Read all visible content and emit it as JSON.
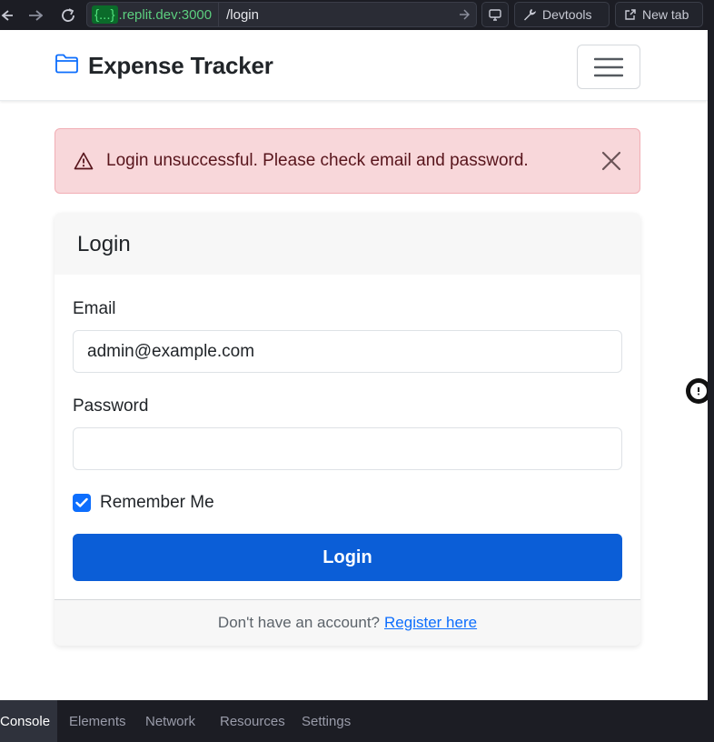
{
  "browser": {
    "url_chip": "{...}",
    "url_host": ".replit.dev:3000",
    "url_path": "/login",
    "devtools_label": "Devtools",
    "newtab_label": "New tab"
  },
  "navbar": {
    "brand_title": "Expense Tracker",
    "brand_icon": "folder-icon",
    "toggler_icon": "hamburger-icon"
  },
  "alert": {
    "message": "Login unsuccessful. Please check email and password.",
    "icon": "warning-icon",
    "color": "#f8d7da"
  },
  "login_card": {
    "title": "Login",
    "email_label": "Email",
    "email_value": "admin@example.com",
    "password_label": "Password",
    "password_value": "",
    "remember_label": "Remember Me",
    "remember_checked": true,
    "submit_label": "Login",
    "footer_text": "Don't have an account?",
    "footer_link": "Register here"
  },
  "colors": {
    "primary": "#0b5ed7",
    "alert_bg": "#f8d7da",
    "alert_text": "#58151c"
  },
  "devtools": {
    "tabs": [
      {
        "label": "Console",
        "active": true
      },
      {
        "label": "Elements",
        "active": false
      },
      {
        "label": "Network",
        "active": false
      },
      {
        "label": "Resources",
        "active": false
      },
      {
        "label": "Settings",
        "active": false
      }
    ]
  }
}
